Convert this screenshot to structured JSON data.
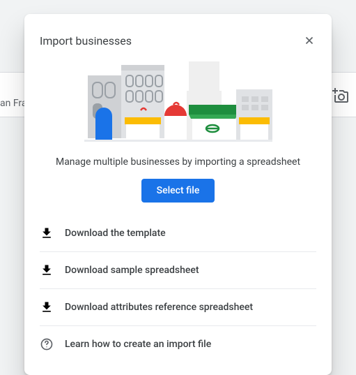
{
  "dialog": {
    "title": "Import businesses",
    "subtitle": "Manage multiple businesses by importing a spreadsheet",
    "select_file_label": "Select file",
    "links": [
      {
        "label": "Download the template",
        "icon": "download"
      },
      {
        "label": "Download sample spreadsheet",
        "icon": "download"
      },
      {
        "label": "Download attributes reference spreadsheet",
        "icon": "download"
      },
      {
        "label": "Learn how to create an import file",
        "icon": "help"
      }
    ]
  },
  "background": {
    "fragment_text": "an Fra"
  }
}
